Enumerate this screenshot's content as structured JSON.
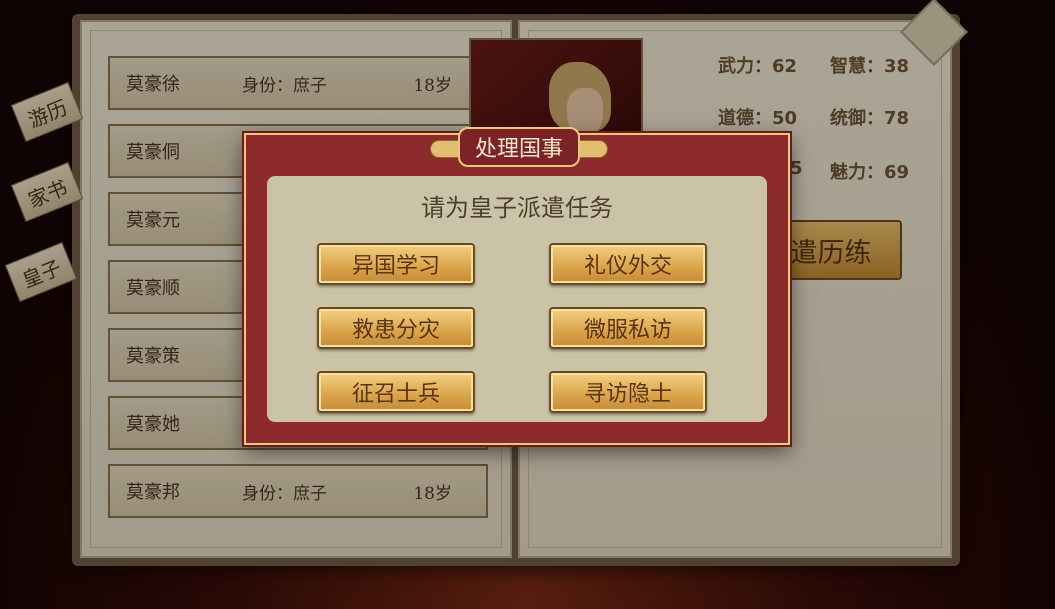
{
  "tabs": [
    {
      "label": "游历"
    },
    {
      "label": "家书"
    },
    {
      "label": "皇子"
    }
  ],
  "prince_list": [
    {
      "name": "莫豪徐",
      "identity": "身份：庶子",
      "age": "18岁"
    },
    {
      "name": "莫豪侗",
      "identity": "",
      "age": ""
    },
    {
      "name": "莫豪元",
      "identity": "",
      "age": ""
    },
    {
      "name": "莫豪顺",
      "identity": "",
      "age": ""
    },
    {
      "name": "莫豪策",
      "identity": "",
      "age": ""
    },
    {
      "name": "莫豪她",
      "identity": "",
      "age": ""
    },
    {
      "name": "莫豪邦",
      "identity": "身份：庶子",
      "age": "18岁"
    }
  ],
  "stats": {
    "force": "武力：62",
    "wisdom": "智慧：38",
    "virtue": "道德：50",
    "command": "统御：78",
    "partial": "5",
    "charm": "魅力：69"
  },
  "dispatch_button": "遣历练",
  "dialog": {
    "title": "处理国事",
    "prompt": "请为皇子派遣任务",
    "tasks": [
      {
        "label": "异国学习"
      },
      {
        "label": "礼仪外交"
      },
      {
        "label": "救患分灾"
      },
      {
        "label": "微服私访"
      },
      {
        "label": "征召士兵"
      },
      {
        "label": "寻访隐士"
      }
    ]
  }
}
